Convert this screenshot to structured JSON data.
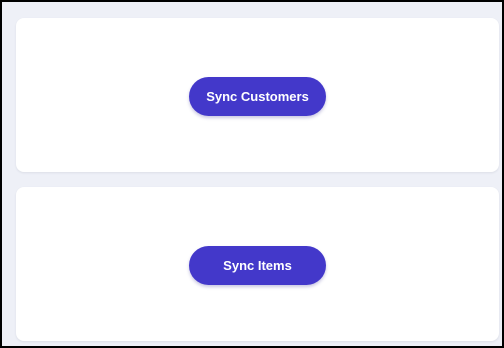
{
  "colors": {
    "accent": "#4338ca",
    "page_background": "#eef0f7",
    "card_background": "#ffffff",
    "button_text": "#ffffff"
  },
  "cards": [
    {
      "button_label": "Sync Customers"
    },
    {
      "button_label": "Sync Items"
    }
  ]
}
